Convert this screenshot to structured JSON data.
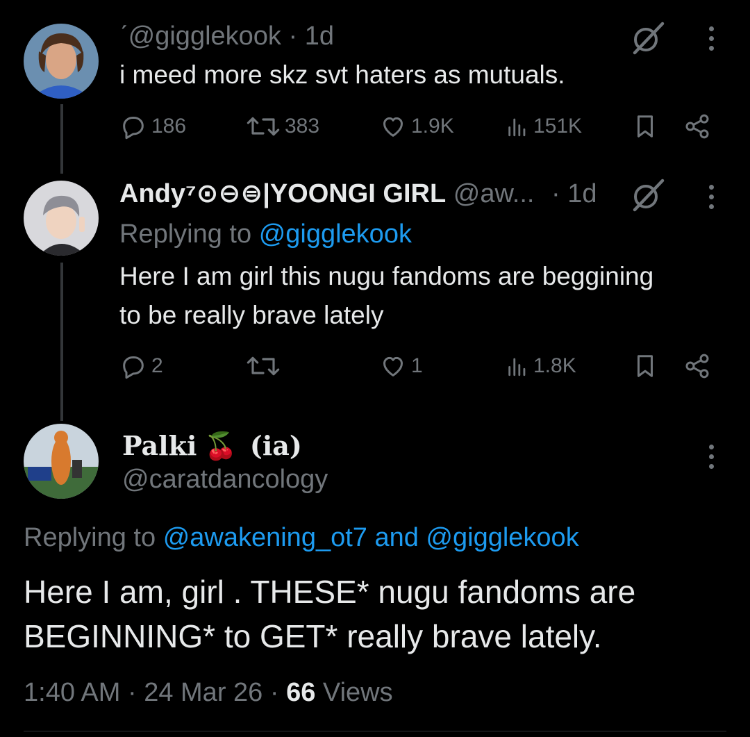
{
  "tweets": [
    {
      "handle_line": "ˊ@gigglekook",
      "dot": "·",
      "time": "1d",
      "text": "i meed more skz svt haters as mutuals.",
      "stats": {
        "replies": "186",
        "reposts": "383",
        "likes": "1.9K",
        "views": "151K"
      }
    },
    {
      "display_name": "Andy⁷⊙⊖⊜|YOONGI GIRL",
      "handle": "@aw...",
      "time": "· 1d",
      "replying_prefix": "Replying to",
      "replying_to": "@gigglekook",
      "text_line1": "Here I am girl this nugu fandoms are beggining",
      "text_line2": "to be really brave lately",
      "stats": {
        "replies": "2",
        "reposts": "",
        "likes": "1",
        "views": "1.8K"
      }
    }
  ],
  "focused_tweet": {
    "display_name": "Palki",
    "name_emoji": "🍒",
    "name_suffix": "(ia)",
    "handle": "@caratdancology",
    "replying_prefix": "Replying to",
    "replying_to": "@awakening_ot7 and @gigglekook",
    "text_line1": "Here I am, girl . THESE* nugu fandoms are",
    "text_line2": "BEGINNING* to GET* really brave lately.",
    "time": "1:40 AM",
    "dot1": "·",
    "date": "24 Mar 26",
    "dot2": "·",
    "views_count": "66",
    "views_label": "Views"
  },
  "colors": {
    "background": "#000000",
    "text": "#e7e9ea",
    "secondary": "#71767b",
    "link": "#1d9bf0",
    "thread_line": "#333639"
  },
  "icons": [
    "reply-icon",
    "repost-icon",
    "like-icon",
    "views-icon",
    "bookmark-icon",
    "share-icon",
    "grok-icon",
    "more-icon"
  ]
}
